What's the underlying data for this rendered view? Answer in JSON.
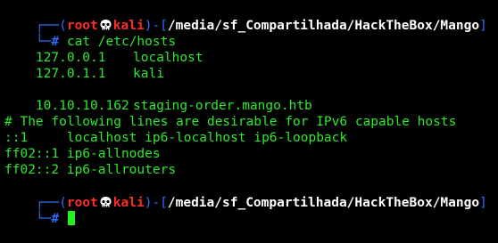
{
  "prompt": {
    "corner_top": "┌──(",
    "user": "root",
    "skull_icon": "skull-icon",
    "host": "kali",
    "sep": ")-[",
    "cwd": "/media/sf_Compartilhada/HackTheBox/Mango",
    "close": "]",
    "corner_bottom": "└─",
    "hash": "#"
  },
  "command": "cat /etc/hosts",
  "hosts": [
    {
      "ip": "127.0.0.1",
      "name": "localhost"
    },
    {
      "ip": "127.0.1.1",
      "name": "kali"
    },
    {
      "ip": "10.10.10.162",
      "name": "staging-order.mango.htb"
    }
  ],
  "comment": "# The following lines are desirable for IPv6 capable hosts",
  "ipv6": [
    "::1     localhost ip6-localhost ip6-loopback",
    "ff02::1 ip6-allnodes",
    "ff02::2 ip6-allrouters"
  ],
  "colors": {
    "background": "#000000",
    "output_green": "#2ee82e",
    "prompt_blue": "#2f6cff",
    "user_red": "#ff2b2b",
    "path_white": "#ffffff",
    "cursor_green": "#1ff21f"
  }
}
